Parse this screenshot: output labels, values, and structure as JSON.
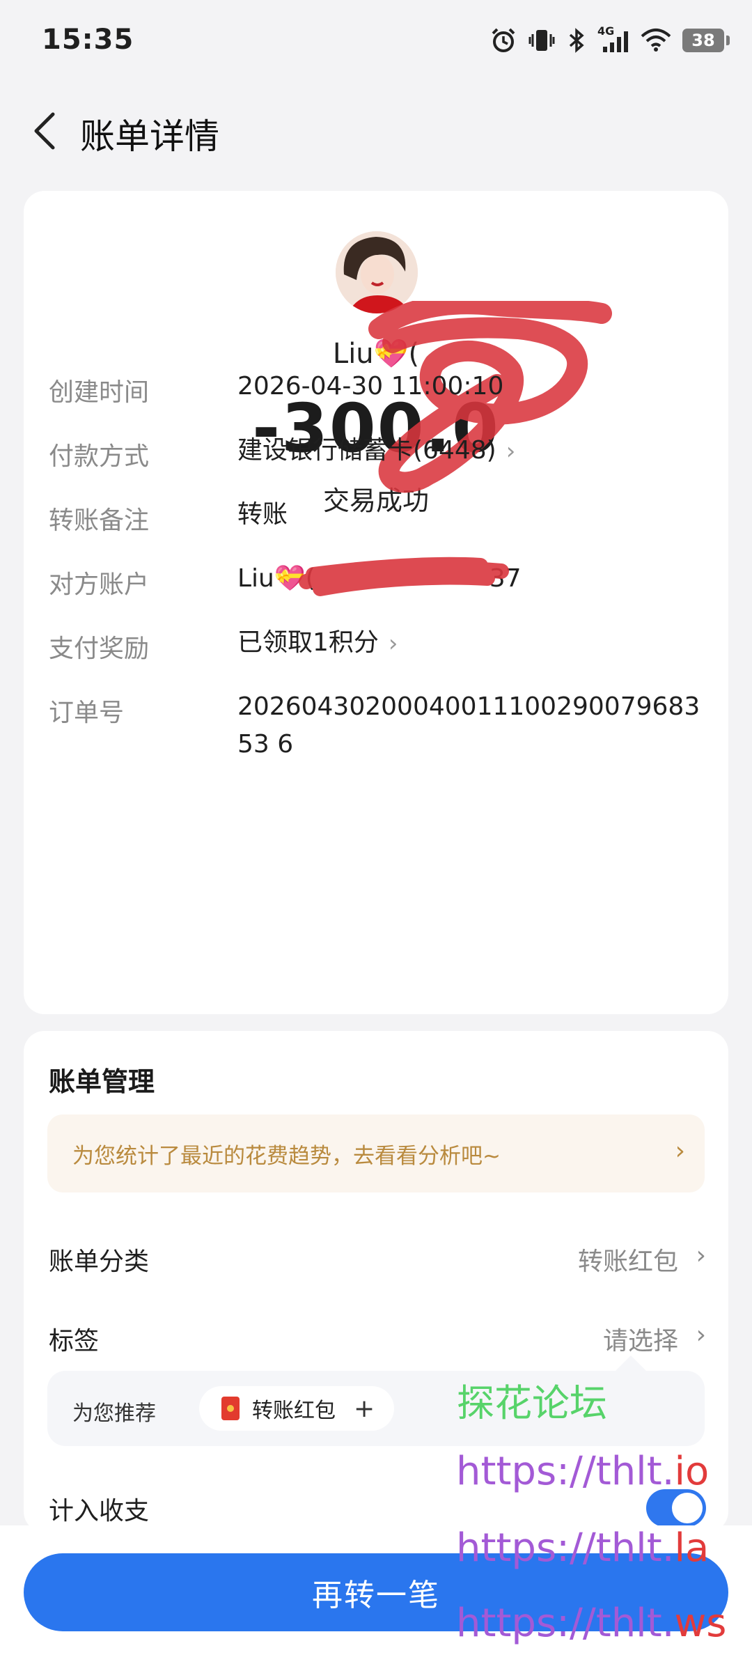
{
  "status_bar": {
    "time": "15:35",
    "network": "4G",
    "battery": "38"
  },
  "header": {
    "title": "账单详情"
  },
  "transaction": {
    "payee_name": "Liu💝(",
    "amount": "-300.0",
    "status": "交易成功"
  },
  "details": {
    "created": {
      "label": "创建时间",
      "value": "2026-04-30 11:00:10"
    },
    "payment": {
      "label": "付款方式",
      "value": "建设银行储蓄卡(6448)"
    },
    "note": {
      "label": "转账备注",
      "value": "转账"
    },
    "account": {
      "label": "对方账户",
      "value_prefix": "Liu💝(",
      "value_suffix": "37"
    },
    "reward": {
      "label": "支付奖励",
      "value": "已领取1积分"
    },
    "order": {
      "label": "订单号",
      "value": "2026043020004001110029007968353 6"
    }
  },
  "bill_management": {
    "title": "账单管理",
    "tip": "为您统计了最近的花费趋势，去看看分析吧~",
    "category": {
      "label": "账单分类",
      "value": "转账红包"
    },
    "tag": {
      "label": "标签",
      "value": "请选择"
    },
    "recommend": {
      "label": "为您推荐",
      "chip": "转账红包",
      "chip_action": "+"
    },
    "include": {
      "label": "计入收支",
      "enabled": true
    }
  },
  "action": {
    "button": "再转一笔"
  },
  "watermark": {
    "forum": "探花论坛",
    "link_base": "https://thlt.",
    "tld_1": "io",
    "tld_2": "la",
    "tld_3": "ws"
  },
  "colors": {
    "accent": "#2a76ee",
    "tip_text": "#b98a3e",
    "scribble": "#d9363e"
  }
}
